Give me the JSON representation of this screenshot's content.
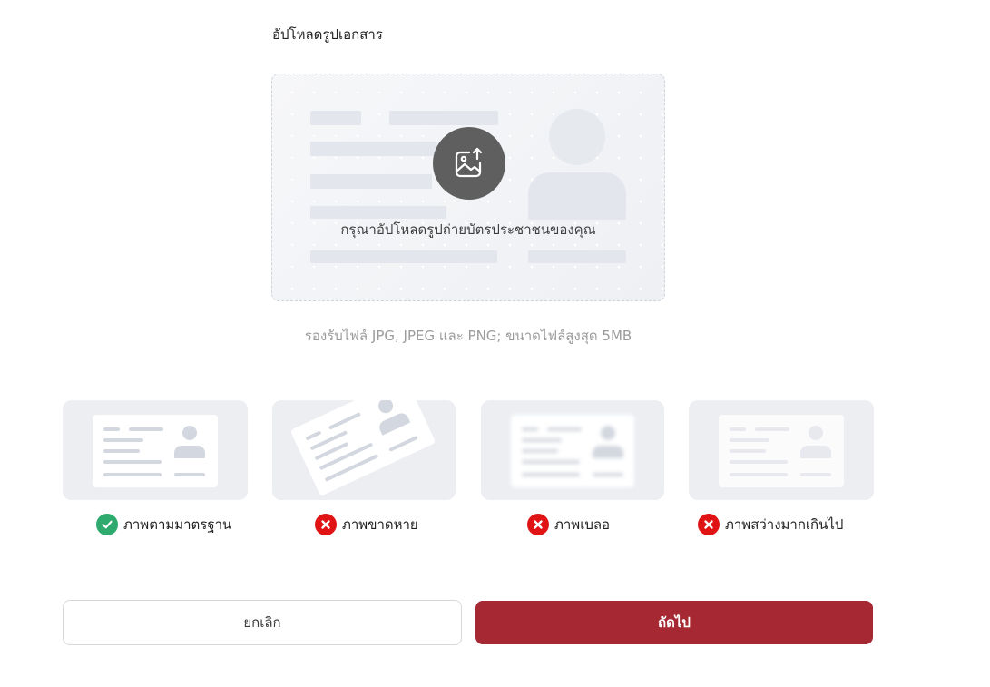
{
  "section_title": "อัปโหลดรูปเอกสาร",
  "upload": {
    "icon": "image-upload-icon",
    "prompt": "กรุณาอัปโหลดรูปถ่ายบัตรประชาชนของคุณ",
    "hint": "รองรับไฟล์ JPG, JPEG และ PNG; ขนาดไฟล์สูงสุด 5MB"
  },
  "examples": [
    {
      "label": "ภาพตามมาตรฐาน",
      "status": "ok",
      "icon": "check-icon"
    },
    {
      "label": "ภาพขาดหาย",
      "status": "bad",
      "icon": "cross-icon"
    },
    {
      "label": "ภาพเบลอ",
      "status": "bad",
      "icon": "cross-icon"
    },
    {
      "label": "ภาพสว่างมากเกินไป",
      "status": "bad",
      "icon": "cross-icon"
    }
  ],
  "actions": {
    "cancel_label": "ยกเลิก",
    "next_label": "ถัดไป"
  },
  "colors": {
    "primary": "#a52832",
    "ok": "#2eaa6e",
    "error": "#e01414"
  }
}
